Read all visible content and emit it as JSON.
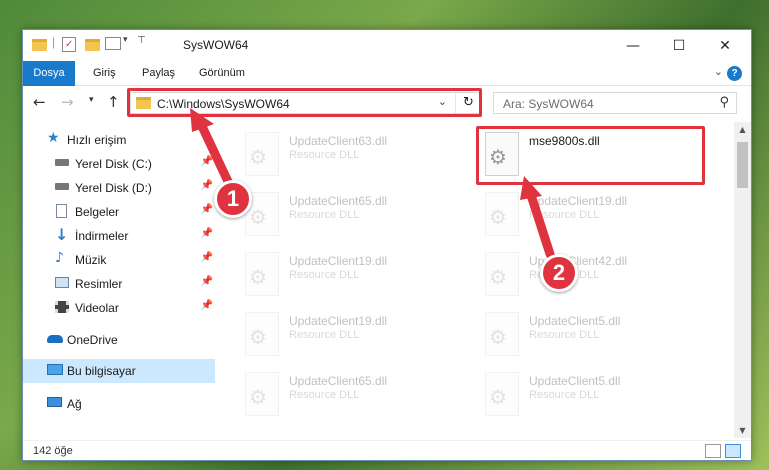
{
  "window": {
    "title": "SysWOW64",
    "controls": {
      "minimize": "—",
      "maximize": "☐",
      "close": "✕"
    }
  },
  "ribbon": {
    "tabs": [
      {
        "label": "Dosya",
        "active": true
      },
      {
        "label": "Giriş",
        "active": false
      },
      {
        "label": "Paylaş",
        "active": false
      },
      {
        "label": "Görünüm",
        "active": false
      }
    ],
    "help": "?"
  },
  "nav": {
    "address": "C:\\Windows\\SysWOW64",
    "search_placeholder": "Ara: SysWOW64"
  },
  "sidebar": {
    "items": [
      {
        "label": "Hızlı erişim",
        "icon": "star-icon",
        "pinned": false
      },
      {
        "label": "Yerel Disk (C:)",
        "icon": "drive-icon",
        "pinned": true
      },
      {
        "label": "Yerel Disk (D:)",
        "icon": "drive-icon",
        "pinned": true
      },
      {
        "label": "Belgeler",
        "icon": "document-icon",
        "pinned": true
      },
      {
        "label": "İndirmeler",
        "icon": "download-icon",
        "pinned": true
      },
      {
        "label": "Müzik",
        "icon": "music-icon",
        "pinned": true
      },
      {
        "label": "Resimler",
        "icon": "pictures-icon",
        "pinned": true
      },
      {
        "label": "Videolar",
        "icon": "video-icon",
        "pinned": true
      },
      {
        "label": "OneDrive",
        "icon": "cloud-icon",
        "pinned": false
      },
      {
        "label": "Bu bilgisayar",
        "icon": "computer-icon",
        "pinned": false,
        "selected": true
      },
      {
        "label": "Ağ",
        "icon": "network-icon",
        "pinned": false
      }
    ]
  },
  "files": [
    {
      "name": "UpdateClient63.dll",
      "type": "Resource DLL",
      "highlighted": false
    },
    {
      "name": "mse9800s.dll",
      "type": "",
      "highlighted": true
    },
    {
      "name": "UpdateClient65.dll",
      "type": "Resource DLL",
      "highlighted": false
    },
    {
      "name": "UpdateClient19.dll",
      "type": "Resource DLL",
      "highlighted": false
    },
    {
      "name": "UpdateClient19.dll",
      "type": "Resource DLL",
      "highlighted": false
    },
    {
      "name": "UpdateClient42.dll",
      "type": "Resource DLL",
      "highlighted": false
    },
    {
      "name": "UpdateClient19.dll",
      "type": "Resource DLL",
      "highlighted": false
    },
    {
      "name": "UpdateClient5.dll",
      "type": "Resource DLL",
      "highlighted": false
    },
    {
      "name": "UpdateClient65.dll",
      "type": "Resource DLL",
      "highlighted": false
    },
    {
      "name": "UpdateClient5.dll",
      "type": "Resource DLL",
      "highlighted": false
    }
  ],
  "status": {
    "count": "142 öğe"
  },
  "callouts": {
    "step1": "1",
    "step2": "2"
  },
  "colors": {
    "accent": "#1979ca",
    "callout": "#e03340",
    "selected": "#cce8ff"
  }
}
